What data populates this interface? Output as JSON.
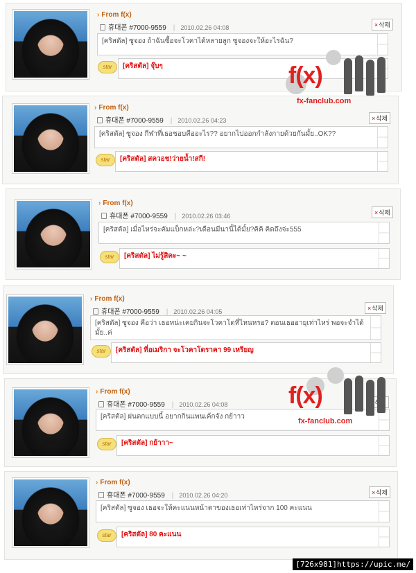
{
  "posts": [
    {
      "from": "From f(x)",
      "author": "휴대폰 #7000-9559",
      "date": "2010.02.26 04:08",
      "delete": "삭제",
      "message": "[คริสตัล] ซูจอง ถ้าฉันซื้อจะโวคาได้หลายลูก ซูจองจะให้อะไรฉัน?",
      "badge": "star",
      "reply": "[คริสตัล] จุ๊บๆ"
    },
    {
      "from": "From f(x)",
      "author": "휴대폰 #7000-9559",
      "date": "2010.02.26 04:23",
      "delete": "삭제",
      "message": "[คริสตัล] ซูจอง กีฬาที่เธอชอบคืออะไร?? อยากไปออกกำลังกายด้วยกันมั้ย..OK??",
      "badge": "star",
      "reply": "[คริสตัล] สควอช!ว่ายน้ำ!สกี!"
    },
    {
      "from": "From f(x)",
      "author": "휴대폰 #7000-9559",
      "date": "2010.02.26 03:46",
      "delete": "삭제",
      "message": "[คริสตัล] เมื่อไหร่จะคัมแบ็กหล่ะ?เดือนมีนานี้ได้มั้ย?คิคิ คิดถึงจ่ะ555",
      "badge": "star",
      "reply": "[คริสตัล] ไม่รู้สิคะ~ ~"
    },
    {
      "from": "From f(x)",
      "author": "휴대폰 #7000-9559",
      "date": "2010.02.26 04:05",
      "delete": "삭제",
      "message": "[คริสตัล] ซูจอง คือว่า เธอทน่ะเคยกินจะโวคาโดที่ไหนหรอ? ตอนเธออายุเท่าไหร่ พอจะจำได้มั้ย..ค่",
      "badge": "star",
      "reply": "[คริสตัล] ที่อเมริกา จะโวคาโดราคา 99 เหรียญ"
    },
    {
      "from": "From f(x)",
      "author": "휴대폰 #7000-9559",
      "date": "2010.02.26 04:08",
      "delete": "삭제",
      "message": "[คริสตัล] ฝนตกแบบนี้ อยากกินแพนเค้กจัง กย้าาว",
      "badge": "star",
      "reply": "[คริสตัล] กย้าาา~"
    },
    {
      "from": "From f(x)",
      "author": "휴대폰 #7000-9559",
      "date": "2010.02.26 04:20",
      "delete": "삭제",
      "message": "[คริสตัล] ซูจอง เธอจะให้คะแนนหน้าตาของเธอเท่าไหร่จาก 100 คะแนน",
      "badge": "star",
      "reply": "[คริสตัล] 80 คะแนน"
    }
  ],
  "watermark": {
    "logo": "f(x)",
    "site": "fx-fanclub.com"
  },
  "footer": {
    "text": "[726x981]https://upic.me/"
  }
}
